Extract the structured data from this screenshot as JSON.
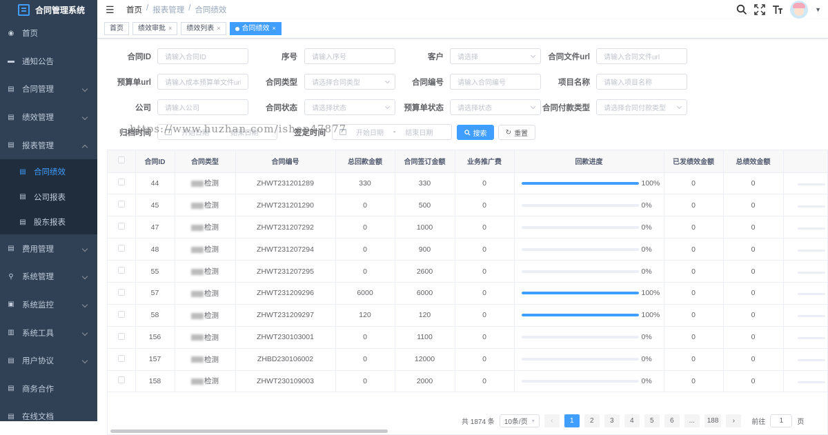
{
  "app": {
    "title": "合同管理系统"
  },
  "sidebar": {
    "items": [
      {
        "label": "首页",
        "icon": "dashboard-icon"
      },
      {
        "label": "通知公告",
        "icon": "message-icon"
      },
      {
        "label": "合同管理",
        "icon": "document-icon",
        "has_arrow": true
      },
      {
        "label": "绩效管理",
        "icon": "document-icon",
        "has_arrow": true
      },
      {
        "label": "报表管理",
        "icon": "document-icon",
        "has_arrow": true,
        "expanded": true
      }
    ],
    "sub_items": [
      {
        "label": "合同绩效",
        "active": true
      },
      {
        "label": "公司报表"
      },
      {
        "label": "股东报表"
      }
    ],
    "items_after": [
      {
        "label": "费用管理",
        "icon": "document-icon",
        "has_arrow": true
      },
      {
        "label": "系统管理",
        "icon": "user-icon",
        "has_arrow": true
      },
      {
        "label": "系统监控",
        "icon": "monitor-icon",
        "has_arrow": true
      },
      {
        "label": "系统工具",
        "icon": "toolbox-icon",
        "has_arrow": true
      },
      {
        "label": "用户协议",
        "icon": "document-icon",
        "has_arrow": true
      },
      {
        "label": "商务合作",
        "icon": "document-icon"
      },
      {
        "label": "在线文档",
        "icon": "document-icon"
      }
    ]
  },
  "navbar": {
    "breadcrumb": [
      "首页",
      "报表管理",
      "合同绩效"
    ],
    "separator": "/"
  },
  "tags": [
    {
      "label": "首页",
      "closable": false
    },
    {
      "label": "绩效审批",
      "closable": true
    },
    {
      "label": "绩效列表",
      "closable": true
    },
    {
      "label": "合同绩效",
      "closable": true,
      "active": true
    }
  ],
  "form": {
    "contract_id": {
      "label": "合同ID",
      "placeholder": "请输入合同ID"
    },
    "seq": {
      "label": "序号",
      "placeholder": "请输入序号"
    },
    "customer": {
      "label": "客户",
      "placeholder": "请选择"
    },
    "file_url": {
      "label": "合同文件url",
      "placeholder": "请输入合同文件url"
    },
    "budget_url": {
      "label": "预算单url",
      "placeholder": "请输入成本预算单文件url"
    },
    "contract_type": {
      "label": "合同类型",
      "placeholder": "请选择合同类型"
    },
    "contract_no": {
      "label": "合同编号",
      "placeholder": "请输入合同编号"
    },
    "project_name": {
      "label": "项目名称",
      "placeholder": "请输入项目名称"
    },
    "company": {
      "label": "公司",
      "placeholder": "请输入公司"
    },
    "contract_status": {
      "label": "合同状态",
      "placeholder": "请选择状态"
    },
    "budget_status": {
      "label": "预算单状态",
      "placeholder": "请选择状态"
    },
    "pay_type": {
      "label": "合同付款类型",
      "placeholder": "请选择合同付款类型"
    },
    "archive_time": {
      "label": "归档时间",
      "start": "开始日期",
      "end": "结束日期",
      "sep": "-"
    },
    "sign_time": {
      "label": "签定时间",
      "start": "开始日期",
      "end": "结束日期",
      "sep": "-"
    },
    "search_btn": "搜索",
    "reset_btn": "重置"
  },
  "table": {
    "columns": [
      "合同ID",
      "合同类型",
      "合同编号",
      "总回款金额",
      "合同签订金额",
      "业务推广费",
      "回款进度",
      "已发绩效金额",
      "总绩效金额"
    ],
    "rows": [
      {
        "id": "44",
        "type": "检测",
        "no": "ZHWT231201289",
        "total_return": "330",
        "sign_amount": "330",
        "promo": "0",
        "progress": 100,
        "progress_text": "100%",
        "paid_perf": "0",
        "total_perf": "0"
      },
      {
        "id": "45",
        "type": "检测",
        "no": "ZHWT231201290",
        "total_return": "0",
        "sign_amount": "500",
        "promo": "0",
        "progress": 0,
        "progress_text": "0%",
        "paid_perf": "0",
        "total_perf": "0"
      },
      {
        "id": "47",
        "type": "检测",
        "no": "ZHWT231207292",
        "total_return": "0",
        "sign_amount": "1000",
        "promo": "0",
        "progress": 0,
        "progress_text": "0%",
        "paid_perf": "0",
        "total_perf": "0"
      },
      {
        "id": "48",
        "type": "检测",
        "no": "ZHWT231207294",
        "total_return": "0",
        "sign_amount": "900",
        "promo": "0",
        "progress": 0,
        "progress_text": "0%",
        "paid_perf": "0",
        "total_perf": "0"
      },
      {
        "id": "55",
        "type": "检测",
        "no": "ZHWT231207295",
        "total_return": "0",
        "sign_amount": "2600",
        "promo": "0",
        "progress": 0,
        "progress_text": "0%",
        "paid_perf": "0",
        "total_perf": "0"
      },
      {
        "id": "57",
        "type": "检测",
        "no": "ZHWT231209296",
        "total_return": "6000",
        "sign_amount": "6000",
        "promo": "0",
        "progress": 100,
        "progress_text": "100%",
        "paid_perf": "0",
        "total_perf": "0"
      },
      {
        "id": "58",
        "type": "检测",
        "no": "ZHWT231209297",
        "total_return": "120",
        "sign_amount": "120",
        "promo": "0",
        "progress": 100,
        "progress_text": "100%",
        "paid_perf": "0",
        "total_perf": "0"
      },
      {
        "id": "156",
        "type": "检测",
        "no": "ZHWT230103001",
        "total_return": "0",
        "sign_amount": "1100",
        "promo": "0",
        "progress": 0,
        "progress_text": "0%",
        "paid_perf": "0",
        "total_perf": "0"
      },
      {
        "id": "157",
        "type": "检测",
        "no": "ZHBD230106002",
        "total_return": "0",
        "sign_amount": "12000",
        "promo": "0",
        "progress": 0,
        "progress_text": "0%",
        "paid_perf": "0",
        "total_perf": "0"
      },
      {
        "id": "158",
        "type": "检测",
        "no": "ZHWT230109003",
        "total_return": "0",
        "sign_amount": "2000",
        "promo": "0",
        "progress": 0,
        "progress_text": "0%",
        "paid_perf": "0",
        "total_perf": "0"
      }
    ]
  },
  "pagination": {
    "total": "共 1874 条",
    "page_size": "10条/页",
    "pages": [
      "1",
      "2",
      "3",
      "4",
      "5",
      "6",
      "...",
      "188"
    ],
    "current": "1",
    "goto_label": "前往",
    "goto_value": "1",
    "page_suffix": "页"
  },
  "watermark": "https://www.huzhan.com/ishop47877",
  "colors": {
    "primary": "#409eff",
    "sidebar_bg": "#304156",
    "sidebar_sub_bg": "#1f2d3d",
    "sidebar_text": "#bfcbd9"
  }
}
